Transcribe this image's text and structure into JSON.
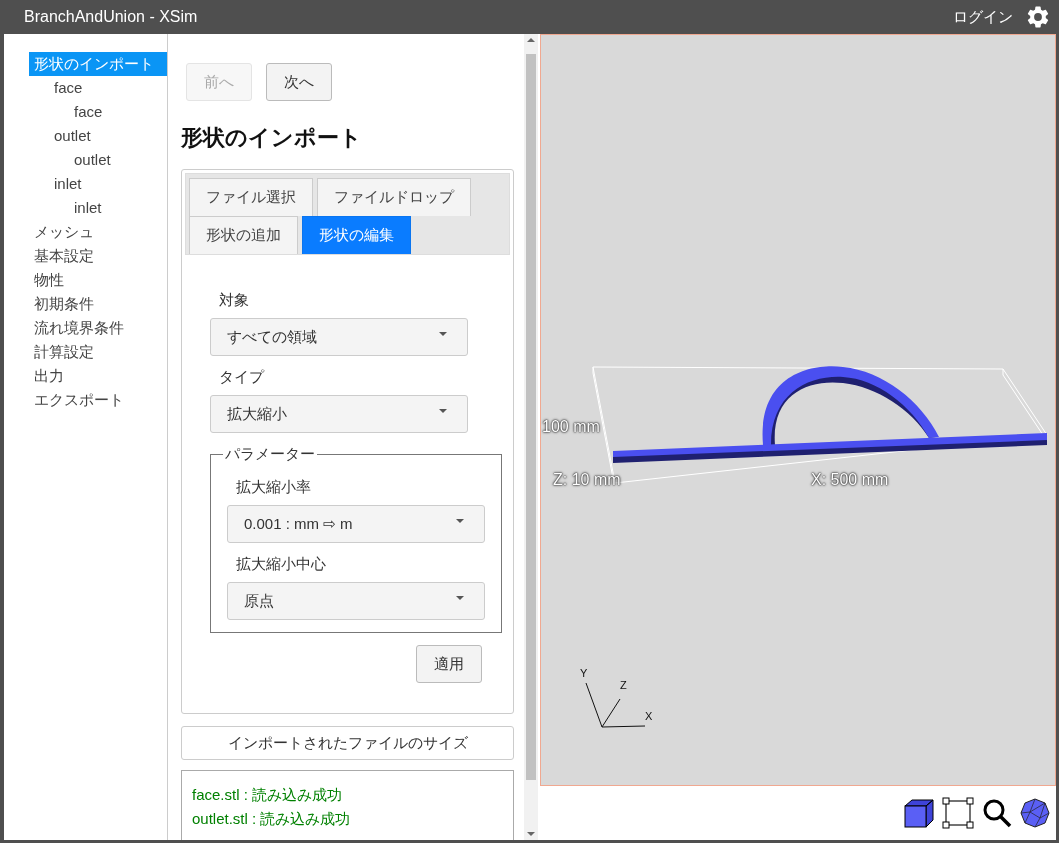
{
  "window": {
    "title": "BranchAndUnion - XSim",
    "login": "ログイン"
  },
  "tree": [
    {
      "label": "形状のインポート",
      "selected": true,
      "children": [
        {
          "label": "face",
          "selected": false,
          "children": [
            {
              "label": "face",
              "selected": false
            }
          ]
        },
        {
          "label": "outlet",
          "selected": false,
          "children": [
            {
              "label": "outlet",
              "selected": false
            }
          ]
        },
        {
          "label": "inlet",
          "selected": false,
          "children": [
            {
              "label": "inlet",
              "selected": false
            }
          ]
        }
      ]
    },
    {
      "label": "メッシュ",
      "selected": false
    },
    {
      "label": "基本設定",
      "selected": false
    },
    {
      "label": "物性",
      "selected": false
    },
    {
      "label": "初期条件",
      "selected": false
    },
    {
      "label": "流れ境界条件",
      "selected": false
    },
    {
      "label": "計算設定",
      "selected": false
    },
    {
      "label": "出力",
      "selected": false
    },
    {
      "label": "エクスポート",
      "selected": false
    }
  ],
  "nav": [
    {
      "label": "前へ",
      "disabled": true
    },
    {
      "label": "次へ",
      "disabled": false
    }
  ],
  "heading": "形状のインポート",
  "tabs": [
    [
      {
        "label": "ファイル選択",
        "selected": false
      },
      {
        "label": "ファイルドロップ",
        "selected": false
      }
    ],
    [
      {
        "label": "形状の追加",
        "selected": false
      },
      {
        "label": "形状の編集",
        "selected": true
      }
    ]
  ],
  "fields": [
    {
      "label": "対象",
      "value": "すべての領域"
    },
    {
      "label": "タイプ",
      "value": "拡大縮小"
    }
  ],
  "parameters": {
    "legend": "パラメーター",
    "fields": [
      {
        "label": "拡大縮小率",
        "value": "0.001 : mm ⇨ m"
      },
      {
        "label": "拡大縮小中心",
        "value": "原点"
      }
    ]
  },
  "apply": "適用",
  "size_button": "インポートされたファイルのサイズ",
  "log": [
    {
      "text": "face.stl : 読み込み成功",
      "color": "#008000"
    },
    {
      "text": "outlet.stl : 読み込み成功",
      "color": "#008000"
    }
  ],
  "viewer": {
    "height_label": "100 mm",
    "z_label": "Z: 10 mm",
    "x_label": "X: 500 mm",
    "axes": [
      "Y",
      "Z",
      "X"
    ]
  }
}
